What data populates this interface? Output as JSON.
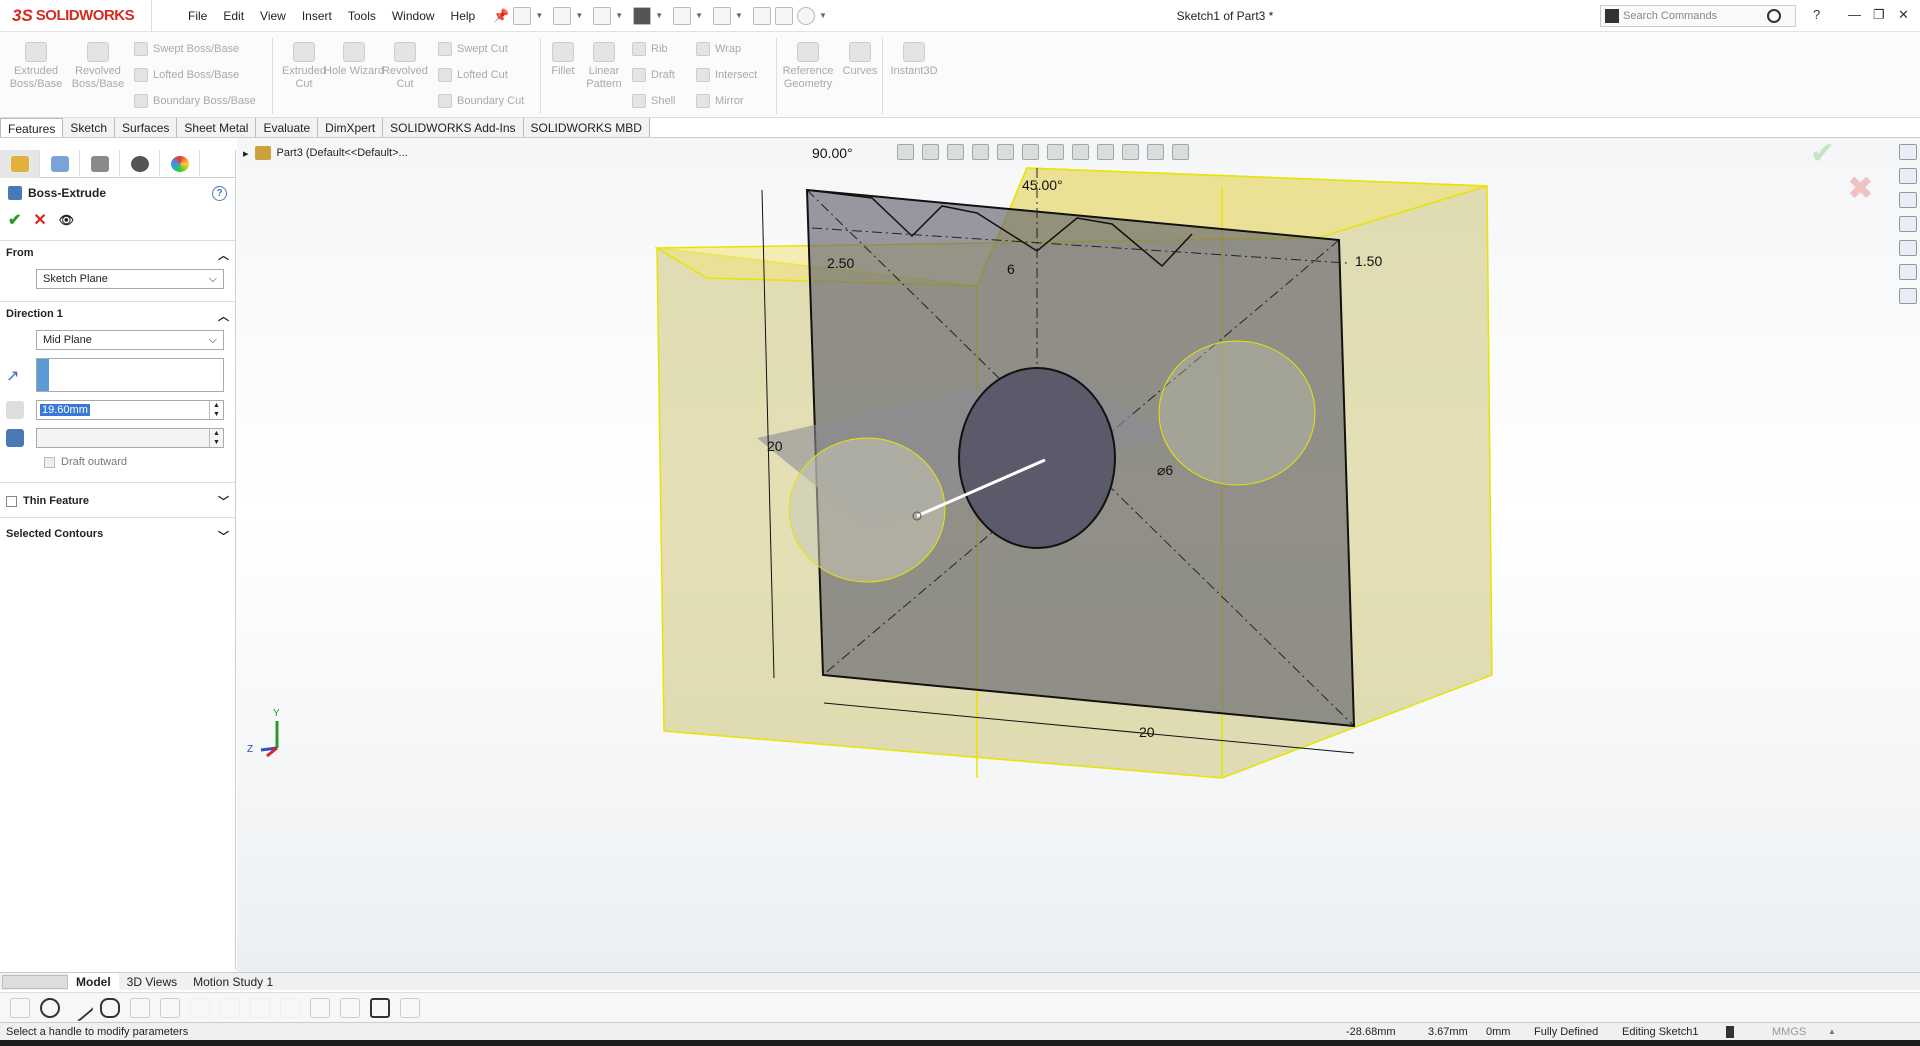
{
  "app": {
    "brand_prefix": "3S",
    "brand_name": "SOLIDWORKS",
    "doc_title": "Sketch1 of Part3 *"
  },
  "menu": [
    "File",
    "Edit",
    "View",
    "Insert",
    "Tools",
    "Window",
    "Help"
  ],
  "search": {
    "placeholder": "Search Commands"
  },
  "window_controls": [
    "?",
    "—",
    "❐",
    "✕"
  ],
  "commands": {
    "extruded_boss": "Extruded Boss/Base",
    "revolved_boss": "Revolved Boss/Base",
    "swept_boss": "Swept Boss/Base",
    "lofted_boss": "Lofted Boss/Base",
    "boundary_boss": "Boundary Boss/Base",
    "extruded_cut": "Extruded Cut",
    "hole_wizard": "Hole Wizard",
    "revolved_cut": "Revolved Cut",
    "swept_cut": "Swept Cut",
    "lofted_cut": "Lofted Cut",
    "boundary_cut": "Boundary Cut",
    "fillet": "Fillet",
    "linear_pattern": "Linear Pattern",
    "rib": "Rib",
    "draft": "Draft",
    "shell": "Shell",
    "wrap": "Wrap",
    "intersect": "Intersect",
    "mirror": "Mirror",
    "reference_geometry": "Reference Geometry",
    "curves": "Curves",
    "instant3d": "Instant3D"
  },
  "tabs": [
    "Features",
    "Sketch",
    "Surfaces",
    "Sheet Metal",
    "Evaluate",
    "DimXpert",
    "SOLIDWORKS Add-Ins",
    "SOLIDWORKS MBD"
  ],
  "tree": {
    "root": "Part3  (Default<<Default>..."
  },
  "property_manager": {
    "title": "Boss-Extrude",
    "help": "?",
    "ok": "✔",
    "cancel": "✕",
    "preview": "👁",
    "from_label": "From",
    "from_value": "Sketch Plane",
    "direction_label": "Direction 1",
    "direction_value": "Mid Plane",
    "depth_value": "19.60mm",
    "draft_outward": "Draft outward",
    "thin_feature": "Thin Feature",
    "selected_contours": "Selected Contours"
  },
  "dimensions": {
    "angle_top": "90.00°",
    "angle_chamfer": "45.00°",
    "width_left": "2.50",
    "pitch": "6",
    "depth_right": "1.50",
    "height": "20",
    "bottom": "20",
    "diameter": "⌀6"
  },
  "triad": {
    "x": "X",
    "y": "Y",
    "z": "Z"
  },
  "bottom_tabs": [
    "Model",
    "3D Views",
    "Motion Study 1"
  ],
  "status": {
    "message": "Select a handle to modify parameters",
    "x": "-28.68mm",
    "y": "3.67mm",
    "z": "0mm",
    "defined": "Fully Defined",
    "editing": "Editing Sketch1",
    "units": "MMGS"
  }
}
